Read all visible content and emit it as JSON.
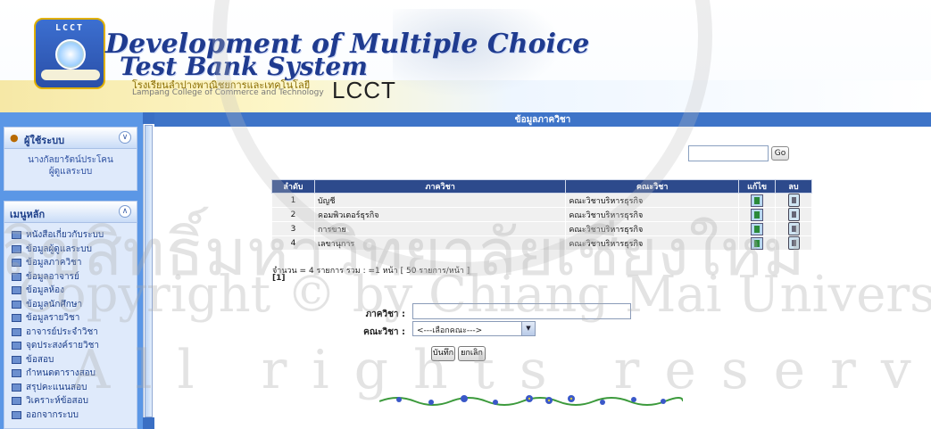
{
  "header": {
    "title_line1": "Development of Multiple Choice",
    "title_line2": "Test Bank System",
    "school_th": "โรงเรียนลำปางพาณิชยการและเทคโนโลยี",
    "school_en": "Lampang College of Commerce and Technology",
    "brand": "LCCT",
    "logo_text": "LCCT"
  },
  "sidebar": {
    "user_panel": {
      "title": "ผู้ใช้ระบบ",
      "user_name": "นางกัลยารัตน์ประโคน",
      "user_role": "ผู้ดูแลระบบ"
    },
    "menu_panel": {
      "title": "เมนูหลัก",
      "items": [
        {
          "label": "หนังสือเกี่ยวกับระบบ"
        },
        {
          "label": "ข้อมูลผู้ดูแลระบบ"
        },
        {
          "label": "ข้อมูลภาควิชา"
        },
        {
          "label": "ข้อมูลอาจารย์"
        },
        {
          "label": "ข้อมูลห้อง"
        },
        {
          "label": "ข้อมูลนักศึกษา"
        },
        {
          "label": "ข้อมูลรายวิชา"
        },
        {
          "label": "อาจารย์ประจำวิชา"
        },
        {
          "label": "จุดประสงค์รายวิชา"
        },
        {
          "label": "ข้อสอบ"
        },
        {
          "label": "กำหนดตารางสอบ"
        },
        {
          "label": "สรุปคะแนนสอบ"
        },
        {
          "label": "วิเคราะห์ข้อสอบ"
        },
        {
          "label": "ออกจากระบบ"
        }
      ]
    }
  },
  "main": {
    "page_title": "ข้อมูลภาควิชา",
    "search": {
      "value": "",
      "go_label": "Go"
    },
    "table": {
      "headers": {
        "no": "ลำดับ",
        "dept": "ภาควิชา",
        "faculty": "คณะวิชา",
        "edit": "แก้ไข",
        "delete": "ลบ"
      },
      "rows": [
        {
          "no": "1",
          "dept": "บัญชี",
          "faculty": "คณะวิชาบริหารธุรกิจ"
        },
        {
          "no": "2",
          "dept": "คอมพิวเตอร์ธุรกิจ",
          "faculty": "คณะวิชาบริหารธุรกิจ"
        },
        {
          "no": "3",
          "dept": "การขาย",
          "faculty": "คณะวิชาบริหารธุรกิจ"
        },
        {
          "no": "4",
          "dept": "เลขานุการ",
          "faculty": "คณะวิชาบริหารธุรกิจ"
        }
      ]
    },
    "summary": "จำนวน = 4 รายการ รวม : =1 หน้า [ 50 รายการ/หน้า ]",
    "pager": "[1]",
    "form": {
      "dept_label": "ภาควิชา :",
      "dept_value": "",
      "faculty_label": "คณะวิชา :",
      "faculty_selected": "<---เลือกคณะ--->",
      "save_label": "บันทึก",
      "cancel_label": "ยกเลิก"
    }
  },
  "watermark": {
    "line1": "ลิขสิทธิ์มหาวิทยาลัยเชียงใหม่",
    "line2": "Copyright © by Chiang Mai University",
    "line3": "All rights reserved"
  },
  "colors": {
    "sidebar": "#5b97e6",
    "table_header": "#2d4a8c",
    "title_blue": "#1f3b8f",
    "main_bar": "#3e74c8"
  }
}
